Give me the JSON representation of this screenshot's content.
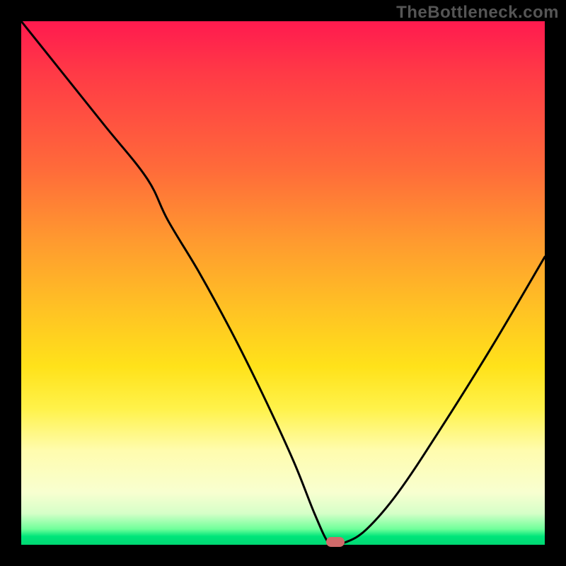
{
  "attribution": "TheBottleneck.com",
  "colors": {
    "frame_bg": "#000000",
    "curve": "#000000",
    "marker": "#d06a6a",
    "gradient_stops": [
      "#ff1a4f",
      "#ff3a46",
      "#ff6a3a",
      "#ff9a2f",
      "#ffc224",
      "#ffe21a",
      "#fff24a",
      "#fffcae",
      "#f8ffd0",
      "#d6ffc8",
      "#6fff9a",
      "#00e57a",
      "#00d873"
    ]
  },
  "chart_data": {
    "type": "line",
    "title": "",
    "subtitle": "",
    "xlabel": "",
    "ylabel": "",
    "xlim": [
      0,
      100
    ],
    "ylim": [
      0,
      100
    ],
    "grid": false,
    "legend": false,
    "series": [
      {
        "name": "bottleneck-curve",
        "x": [
          0,
          8,
          16,
          24,
          28,
          34,
          40,
          46,
          52,
          56,
          58.6,
          60,
          62,
          66,
          72,
          80,
          90,
          100
        ],
        "y": [
          100,
          90,
          80,
          70,
          62,
          52,
          41,
          29,
          16,
          6,
          0.5,
          0.5,
          0.5,
          3,
          10,
          22,
          38,
          55
        ]
      }
    ],
    "annotations": [
      {
        "name": "optimum-marker",
        "x": 60,
        "y": 0.5,
        "shape": "pill",
        "color": "#d06a6a"
      }
    ],
    "notes": "x is relative horizontal position (0..100), y is bottleneck intensity in percent (0 = no bottleneck / green band at bottom, 100 = worst / top red). Values estimated from pixels; no axes or ticks are drawn in the source image."
  }
}
